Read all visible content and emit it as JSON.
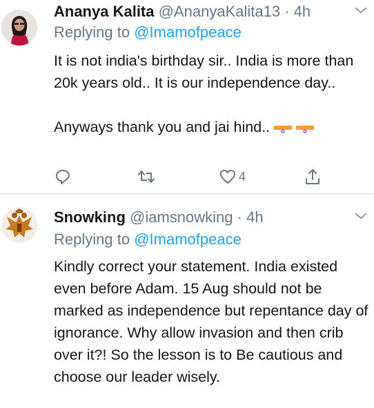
{
  "tweets": [
    {
      "name": "Ananya Kalita",
      "handle": "@AnanyaKalita13",
      "separator": "·",
      "time": "4h",
      "replying_prefix": "Replying to ",
      "replying_to": "@Imamofpeace",
      "body": [
        "It is not india's birthday sir.. India is more than 20k years old.. It is our independence day..",
        "Anyways thank you and jai hind.."
      ],
      "actions": {
        "like_count": "4"
      }
    },
    {
      "name": "Snowking",
      "handle": "@iamsnowking",
      "separator": "·",
      "time": "4h",
      "replying_prefix": "Replying to ",
      "replying_to": "@Imamofpeace",
      "body": [
        "Kindly correct your statement. India existed even before Adam. 15 Aug should not be marked as independence but repentance day of ignorance. Why allow invasion and then crib over it?! So the lesson is to Be cautious and choose our leader wisely."
      ]
    }
  ],
  "colors": {
    "text": "#14171a",
    "secondary": "#657786",
    "link": "#1da1f2",
    "divider": "#e6ecf0"
  },
  "icons": [
    "chevron-down-icon",
    "reply-icon",
    "retweet-icon",
    "heart-icon",
    "share-icon",
    "india-flag-icon"
  ]
}
